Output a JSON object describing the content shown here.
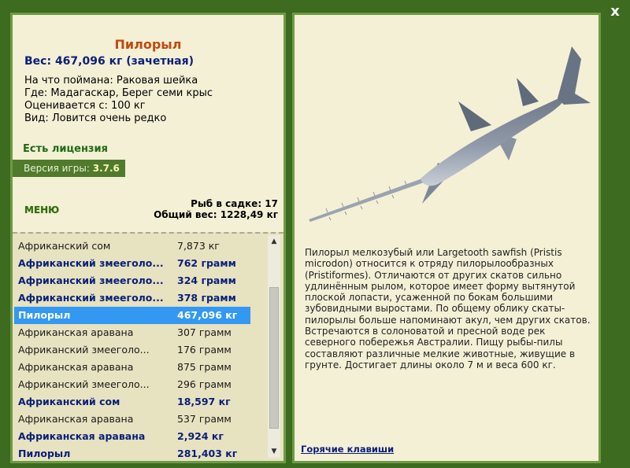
{
  "close_label": "x",
  "fish": {
    "name": "Пилорыл",
    "weight_line": "Вес: 467,096 кг (зачетная)",
    "caught_on": "На что поймана: Раковая шейка",
    "location": "Где: Мадагаскар, Берег семи крыс",
    "valued_from": "Оценивается с: 100 кг",
    "rarity": "Вид: Ловится очень редко",
    "description": "Пилорыл мелкозубый или Largetooth sawfish (Pristis microdon) относится к отряду пилорылообразных (Pristiformes). Отличаются от других скатов сильно удлинённым рылом, которое имеет форму вытянутой плоской лопасти, усаженной по бокам большими зубовидными выростами. По общему облику скаты-пилорылы больше напоминают акул, чем других скатов. Встречаются в солоноватой и пресной воде рек северного побережья Австралии. Пищу рыбы-пилы составляют различные мелкие животные, живущие в грунте. Достигает длины около 7 м и веса 600 кг."
  },
  "license": "Есть лицензия",
  "version_label": "Версия игры:",
  "version_number": "3.7.6",
  "menu_label": "МЕНЮ",
  "keep_count": "Рыб в садке: 17",
  "total_weight": "Общий вес: 1228,49 кг",
  "catch_list": [
    {
      "name": "Африканский сом",
      "weight": "7,873 кг",
      "style": "normal"
    },
    {
      "name": "Африканский змееголо...",
      "weight": "762 грамм",
      "style": "bold"
    },
    {
      "name": "Африканский змееголо...",
      "weight": "324 грамм",
      "style": "bold"
    },
    {
      "name": "Африканский змееголо...",
      "weight": "378 грамм",
      "style": "bold"
    },
    {
      "name": "Пилорыл",
      "weight": "467,096 кг",
      "style": "selected"
    },
    {
      "name": "Африканская аравана",
      "weight": "307 грамм",
      "style": "normal"
    },
    {
      "name": "Африканский змееголо...",
      "weight": "176 грамм",
      "style": "normal"
    },
    {
      "name": "Африканская аравана",
      "weight": "875 грамм",
      "style": "normal"
    },
    {
      "name": "Африканский змееголо...",
      "weight": "296 грамм",
      "style": "normal"
    },
    {
      "name": "Африканский сом",
      "weight": "18,597 кг",
      "style": "bold"
    },
    {
      "name": "Африканская аравана",
      "weight": "537 грамм",
      "style": "normal"
    },
    {
      "name": "Африканская аравана",
      "weight": "2,924 кг",
      "style": "bold"
    },
    {
      "name": "Пилорыл",
      "weight": "281,403 кг",
      "style": "bold"
    }
  ],
  "hotkeys_label": "Горячие клавиши",
  "icons": {
    "close": "close-icon",
    "scroll_up": "chevron-up-icon",
    "scroll_down": "chevron-down-icon"
  },
  "colors": {
    "background": "#3d6b1f",
    "panel": "#f4f0d6",
    "accent": "#bf4a11",
    "selection": "#3398f2",
    "link": "#0a1f7a"
  }
}
